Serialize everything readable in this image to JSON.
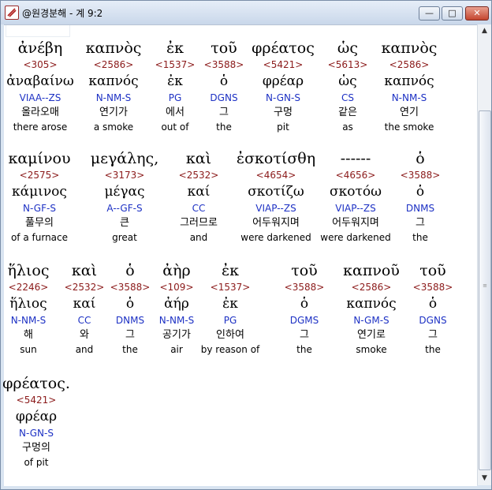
{
  "window": {
    "title": "@원경분해 - 계 9:2",
    "min_glyph": "—",
    "max_glyph": "□",
    "close_glyph": "✕"
  },
  "scrollbar": {
    "up": "▲",
    "down": "▼",
    "grip": "≡"
  },
  "rows": [
    {
      "words": [
        {
          "greek": "ἀνέβη",
          "strong": "<305>",
          "lemma": "ἀναβαίνω",
          "parse": "VIAA--ZS",
          "korean": "올라오매",
          "english": "there arose"
        },
        {
          "greek": "καπνὸς",
          "strong": "<2586>",
          "lemma": "καπνός",
          "parse": "N-NM-S",
          "korean": "연기가",
          "english": "a smoke"
        },
        {
          "greek": "ἐκ",
          "strong": "<1537>",
          "lemma": "ἐκ",
          "parse": "PG",
          "korean": "에서",
          "english": "out of"
        },
        {
          "greek": "τοῦ",
          "strong": "<3588>",
          "lemma": "ὁ",
          "parse": "DGNS",
          "korean": "그",
          "english": "the"
        },
        {
          "greek": "φρέατος",
          "strong": "<5421>",
          "lemma": "φρέαρ",
          "parse": "N-GN-S",
          "korean": "구멍",
          "english": "pit"
        },
        {
          "greek": "ὡς",
          "strong": "<5613>",
          "lemma": "ὡς",
          "parse": "CS",
          "korean": "같은",
          "english": "as"
        },
        {
          "greek": "καπνὸς",
          "strong": "<2586>",
          "lemma": "καπνός",
          "parse": "N-NM-S",
          "korean": "연기",
          "english": "the smoke"
        }
      ]
    },
    {
      "words": [
        {
          "greek": "καμίνου",
          "strong": "<2575>",
          "lemma": "κάμινος",
          "parse": "N-GF-S",
          "korean": "풀무의",
          "english": "of a furnace"
        },
        {
          "greek": "μεγάλης,",
          "strong": "<3173>",
          "lemma": "μέγας",
          "parse": "A--GF-S",
          "korean": "큰",
          "english": "great"
        },
        {
          "greek": "καὶ",
          "strong": "<2532>",
          "lemma": "καί",
          "parse": "CC",
          "korean": "그러므로",
          "english": "and"
        },
        {
          "greek": "ἐσκοτίσθη",
          "strong": "<4654>",
          "lemma": "σκοτίζω",
          "parse": "VIAP--ZS",
          "korean": "어두워지며",
          "english": "were darkened"
        },
        {
          "greek": "------",
          "strong": "<4656>",
          "lemma": "σκοτόω",
          "parse": "VIAP--ZS",
          "korean": "어두워지며",
          "english": "were darkened"
        },
        {
          "greek": "ὁ",
          "strong": "<3588>",
          "lemma": "ὁ",
          "parse": "DNMS",
          "korean": "그",
          "english": "the"
        }
      ]
    },
    {
      "words": [
        {
          "greek": "ἥλιος",
          "strong": "<2246>",
          "lemma": "ἥλιος",
          "parse": "N-NM-S",
          "korean": "해",
          "english": "sun"
        },
        {
          "greek": "καὶ",
          "strong": "<2532>",
          "lemma": "καί",
          "parse": "CC",
          "korean": "와",
          "english": "and"
        },
        {
          "greek": "ὁ",
          "strong": "<3588>",
          "lemma": "ὁ",
          "parse": "DNMS",
          "korean": "그",
          "english": "the"
        },
        {
          "greek": "ἀὴρ",
          "strong": "<109>",
          "lemma": "ἀήρ",
          "parse": "N-NM-S",
          "korean": "공기가",
          "english": "air"
        },
        {
          "greek": "ἐκ",
          "strong": "<1537>",
          "lemma": "ἐκ",
          "parse": "PG",
          "korean": "인하여",
          "english": "by reason of"
        },
        {
          "greek": "τοῦ",
          "strong": "<3588>",
          "lemma": "ὁ",
          "parse": "DGMS",
          "korean": "그",
          "english": "the"
        },
        {
          "greek": "καπνοῦ",
          "strong": "<2586>",
          "lemma": "καπνός",
          "parse": "N-GM-S",
          "korean": "연기로",
          "english": "smoke"
        },
        {
          "greek": "τοῦ",
          "strong": "<3588>",
          "lemma": "ὁ",
          "parse": "DGNS",
          "korean": "그",
          "english": "the"
        }
      ]
    },
    {
      "words": [
        {
          "greek": "φρέατος.",
          "strong": "<5421>",
          "lemma": "φρέαρ",
          "parse": "N-GN-S",
          "korean": "구멍의",
          "english": "of pit"
        }
      ]
    }
  ]
}
